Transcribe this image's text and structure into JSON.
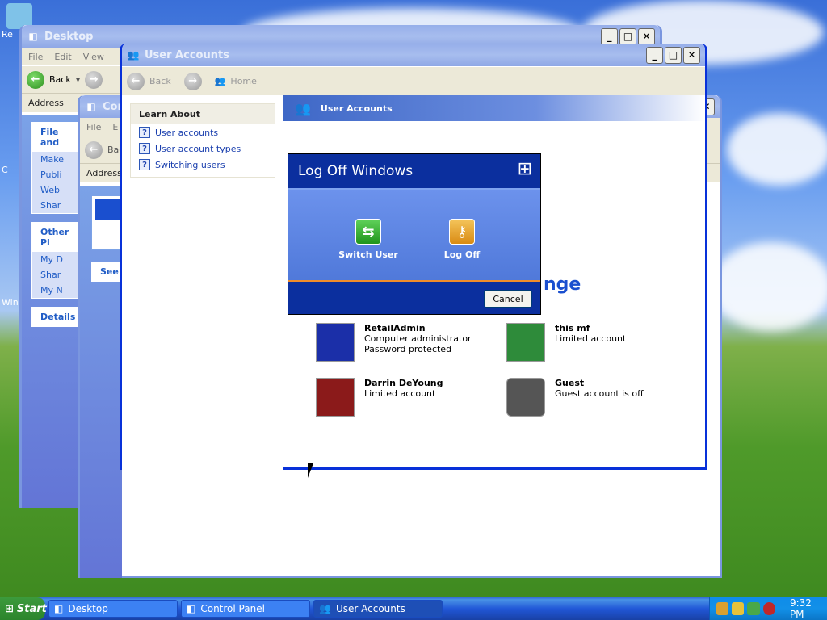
{
  "desktop": {
    "icons": [
      {
        "label": "Re"
      },
      {
        "label": "C"
      },
      {
        "label": "Wind"
      }
    ]
  },
  "window_desktop": {
    "title": "Desktop",
    "menu": [
      "File",
      "Edit",
      "View"
    ],
    "back_label": "Back",
    "address_label": "Address",
    "file_tasks_header": "File and",
    "file_tasks": [
      "Make",
      "Publi",
      "Web",
      "Shar"
    ],
    "other_places_header": "Other Pl",
    "other_places": [
      "My D",
      "Shar",
      "My N"
    ],
    "details_header": "Details"
  },
  "window_control_panel": {
    "title": "Con",
    "menu": [
      "File",
      "E"
    ],
    "back_label": "Back",
    "address_label": "Address",
    "see_also_header": "See"
  },
  "window_user_accounts": {
    "title": "User Accounts",
    "nav": {
      "back": "Back",
      "home": "Home"
    },
    "learn_about": {
      "header": "Learn About",
      "items": [
        "User accounts",
        "User account types",
        "Switching users"
      ]
    },
    "banner_title": "User Accounts",
    "partial_heading": "nge",
    "accounts": [
      {
        "name": "RetailAdmin",
        "desc1": "Computer administrator",
        "desc2": "Password protected",
        "pic_color": "#1b2fa8"
      },
      {
        "name": "this mf",
        "desc1": "Limited account",
        "desc2": "",
        "pic_color": "#2e8b3a"
      },
      {
        "name": "Darrin DeYoung",
        "desc1": "Limited account",
        "desc2": "",
        "pic_color": "#8b1a1a"
      },
      {
        "name": "Guest",
        "desc1": "Guest account is off",
        "desc2": "",
        "pic_color": "#555555"
      }
    ]
  },
  "logoff_dialog": {
    "title": "Log Off Windows",
    "switch_user": "Switch User",
    "log_off": "Log Off",
    "cancel": "Cancel"
  },
  "taskbar": {
    "start": "Start",
    "tasks": [
      "Desktop",
      "Control Panel",
      "User Accounts"
    ],
    "clock": "9:32 PM"
  }
}
